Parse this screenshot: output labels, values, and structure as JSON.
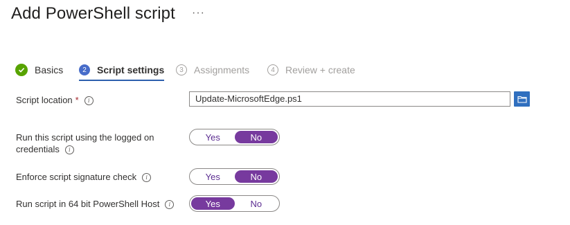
{
  "page": {
    "title": "Add PowerShell script",
    "more": "···"
  },
  "steps": [
    {
      "number": "✓",
      "label": "Basics",
      "state": "done"
    },
    {
      "number": "2",
      "label": "Script settings",
      "state": "current"
    },
    {
      "number": "3",
      "label": "Assignments",
      "state": "future"
    },
    {
      "number": "4",
      "label": "Review + create",
      "state": "future"
    }
  ],
  "form": {
    "script_location": {
      "label": "Script location",
      "required_marker": "*",
      "info": "i",
      "value": "Update-MicrosoftEdge.ps1",
      "browse_icon": "folder-icon"
    },
    "run_logged_on": {
      "label_line1": "Run this script using the logged on",
      "label_line2": "credentials",
      "info": "i",
      "yes": "Yes",
      "no": "No",
      "selected": "No"
    },
    "signature_check": {
      "label": "Enforce script signature check",
      "info": "i",
      "yes": "Yes",
      "no": "No",
      "selected": "No"
    },
    "run_64bit": {
      "label": "Run script in 64 bit PowerShell Host",
      "info": "i",
      "yes": "Yes",
      "no": "No",
      "selected": "Yes"
    }
  },
  "colors": {
    "accent_purple": "#773a9e",
    "step_done": "#57a300",
    "step_current": "#476cc9",
    "browse_button": "#2f6fbf"
  }
}
